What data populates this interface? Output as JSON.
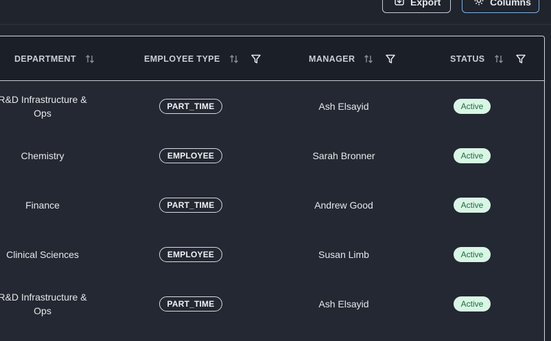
{
  "toolbar": {
    "export_label": "Export",
    "columns_label": "Columns"
  },
  "table": {
    "headers": {
      "department": "DEPARTMENT",
      "employee_type": "EMPLOYEE TYPE",
      "manager": "MANAGER",
      "status": "STATUS"
    },
    "rows": [
      {
        "department": "R&D Infrastructure & Ops",
        "employee_type": "PART_TIME",
        "manager": "Ash Elsayid",
        "status": "Active"
      },
      {
        "department": "Chemistry",
        "employee_type": "EMPLOYEE",
        "manager": "Sarah Bronner",
        "status": "Active"
      },
      {
        "department": "Finance",
        "employee_type": "PART_TIME",
        "manager": "Andrew Good",
        "status": "Active"
      },
      {
        "department": "Clinical Sciences",
        "employee_type": "EMPLOYEE",
        "manager": "Susan Limb",
        "status": "Active"
      },
      {
        "department": "R&D Infrastructure & Ops",
        "employee_type": "PART_TIME",
        "manager": "Ash Elsayid",
        "status": "Active"
      }
    ]
  },
  "colors": {
    "background": "#1f242d",
    "header_background": "#1b1f27",
    "status_active_bg": "#d9f6e5",
    "status_active_text": "#1c6b3f",
    "columns_button_border": "#7fb2e5"
  },
  "icons": {
    "export": "export-icon",
    "columns": "gear-icon",
    "sort": "sort-arrows-icon",
    "filter": "filter-icon"
  }
}
